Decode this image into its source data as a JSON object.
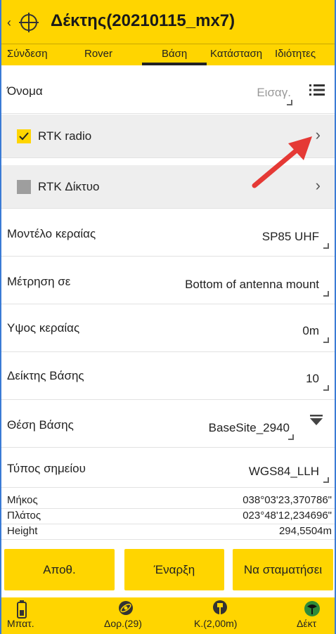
{
  "header": {
    "title": "Δέκτης(20210115_mx7)"
  },
  "tabs": [
    {
      "label": "Σύνδεση"
    },
    {
      "label": "Rover"
    },
    {
      "label": "Βάση",
      "selected": true
    },
    {
      "label": "Κατάσταση"
    },
    {
      "label": "Ιδιότητες"
    }
  ],
  "fields": {
    "name": {
      "label": "Όνομα",
      "placeholder": "Εισαγ."
    },
    "rtk_radio": {
      "label": "RTK radio",
      "checked": true
    },
    "rtk_network": {
      "label": "RTK Δίκτυο",
      "checked": false
    },
    "antenna_model": {
      "label": "Μοντέλο κεραίας",
      "value": "SP85 UHF"
    },
    "measured_to": {
      "label": "Μέτρηση σε",
      "value": "Bottom of antenna mount"
    },
    "antenna_height": {
      "label": "Υψος κεραίας",
      "value": "0m"
    },
    "base_index": {
      "label": "Δείκτης Βάσης",
      "value": "10"
    },
    "base_position": {
      "label": "Θέση Βάσης",
      "value": "BaseSite_2940"
    },
    "point_type": {
      "label": "Τύπος σημείου",
      "value": "WGS84_LLH"
    }
  },
  "coords": {
    "longitude": {
      "label": "Μήκος",
      "value": "038°03'23,370786\""
    },
    "latitude": {
      "label": "Πλάτος",
      "value": "023°48'12,234696\""
    },
    "height": {
      "label": "Height",
      "value": "294,5504m"
    }
  },
  "buttons": {
    "save": "Αποθ.",
    "start": "Έναρξη",
    "stop": "Να σταματήσει"
  },
  "statusbar": {
    "battery": "Μπατ.",
    "satellites": "Δορ.(29)",
    "pole": "Κ.(2,00m)",
    "receiver": "Δέκτ"
  },
  "colors": {
    "accent": "#ffd500",
    "check": "#ffd500",
    "annotation_arrow": "#e53935",
    "receiver_icon": "#2e8b3a"
  }
}
